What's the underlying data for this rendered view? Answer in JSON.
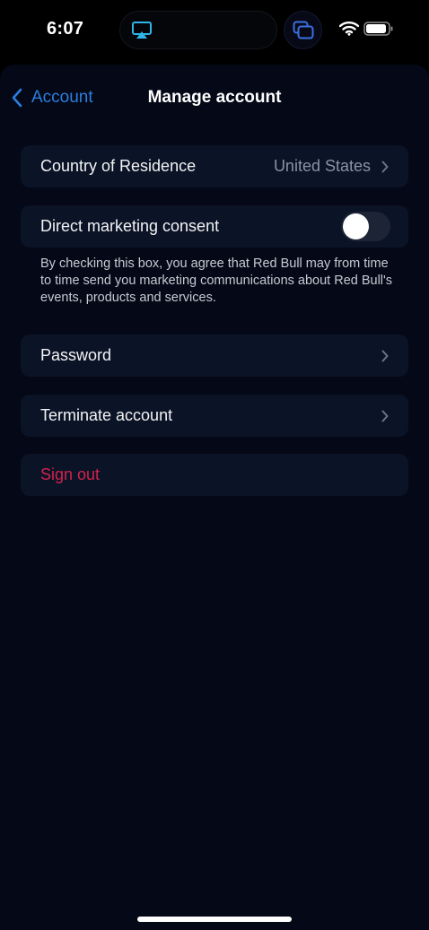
{
  "status_bar": {
    "time": "6:07",
    "icons": [
      "airplay-icon",
      "screen-share-icon",
      "wifi-icon",
      "battery-icon"
    ]
  },
  "nav": {
    "back_label": "Account",
    "title": "Manage account"
  },
  "rows": {
    "country": {
      "label": "Country of Residence",
      "value": "United States"
    },
    "marketing": {
      "label": "Direct marketing consent",
      "enabled": false
    },
    "password": {
      "label": "Password"
    },
    "terminate": {
      "label": "Terminate account"
    },
    "signout": {
      "label": "Sign out"
    }
  },
  "consent_note": "By checking this box, you agree that Red Bull may from time to time send you marketing communications about Red Bull's events, products and services.",
  "colors": {
    "background": "#000000",
    "sheet": "#050816",
    "row": "#0b1326",
    "accent_blue": "#2a7fe0",
    "destructive_red": "#d1234e",
    "muted_text": "#8a93a6"
  }
}
